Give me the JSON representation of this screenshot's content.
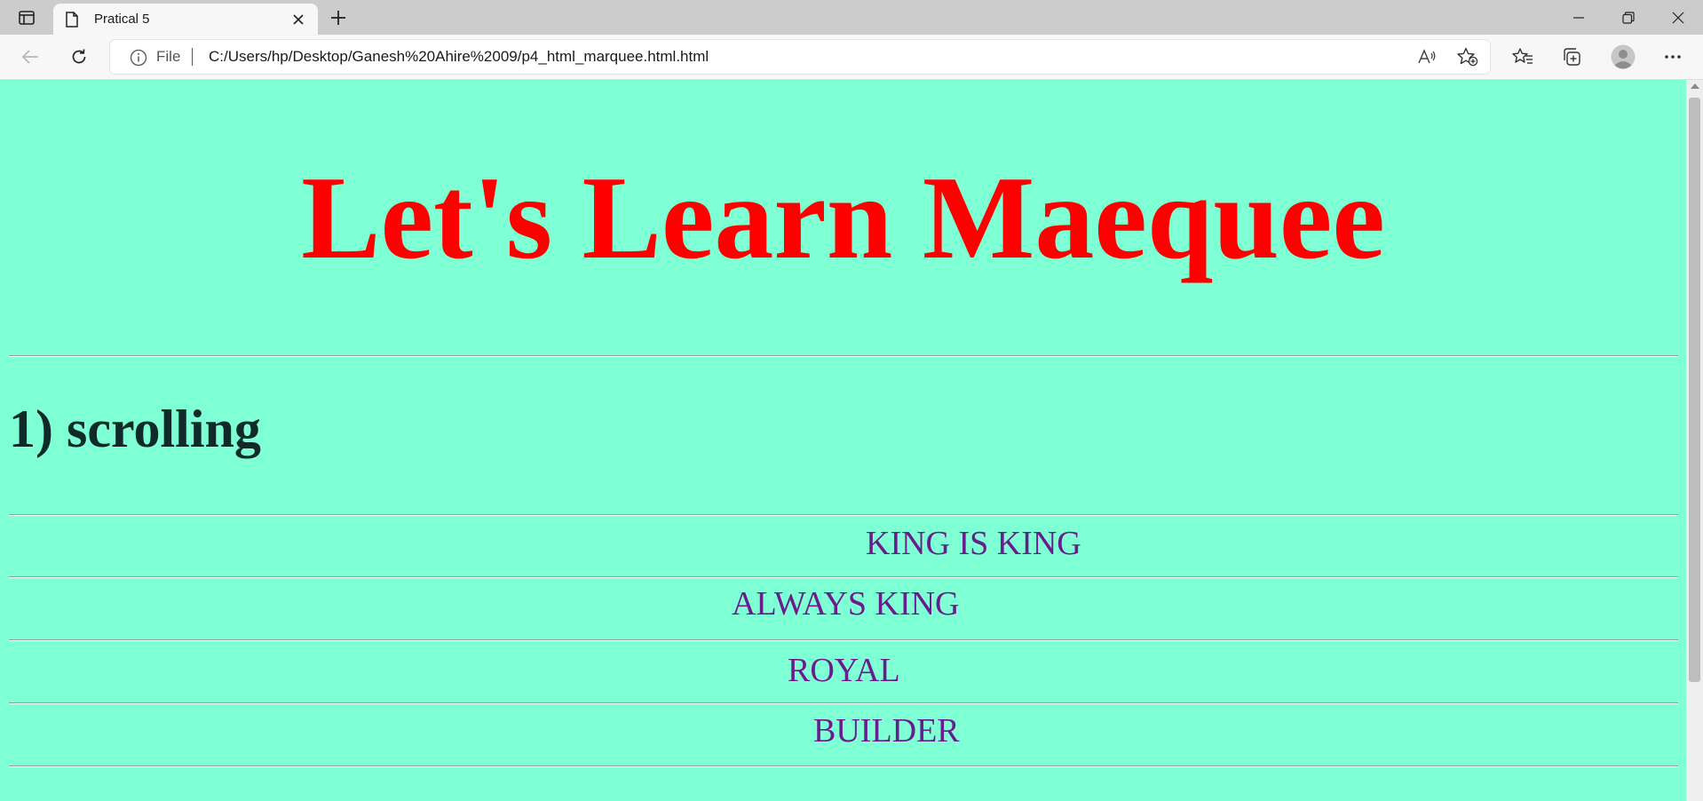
{
  "browser": {
    "tab": {
      "title": "Pratical 5"
    },
    "address": {
      "scheme_label": "File",
      "url": "C:/Users/hp/Desktop/Ganesh%20Ahire%2009/p4_html_marquee.html.html"
    }
  },
  "page": {
    "background": "#7fffd4",
    "heading": {
      "text": "Let's Learn Maequee",
      "color": "#ff0000"
    },
    "section_title": "1) scrolling",
    "marquees": [
      {
        "text": "KING IS KING"
      },
      {
        "text": "ALWAYS KING"
      },
      {
        "text": "ROYAL"
      },
      {
        "text": "BUILDER"
      }
    ],
    "marquee_color": "#6a1c8c"
  }
}
